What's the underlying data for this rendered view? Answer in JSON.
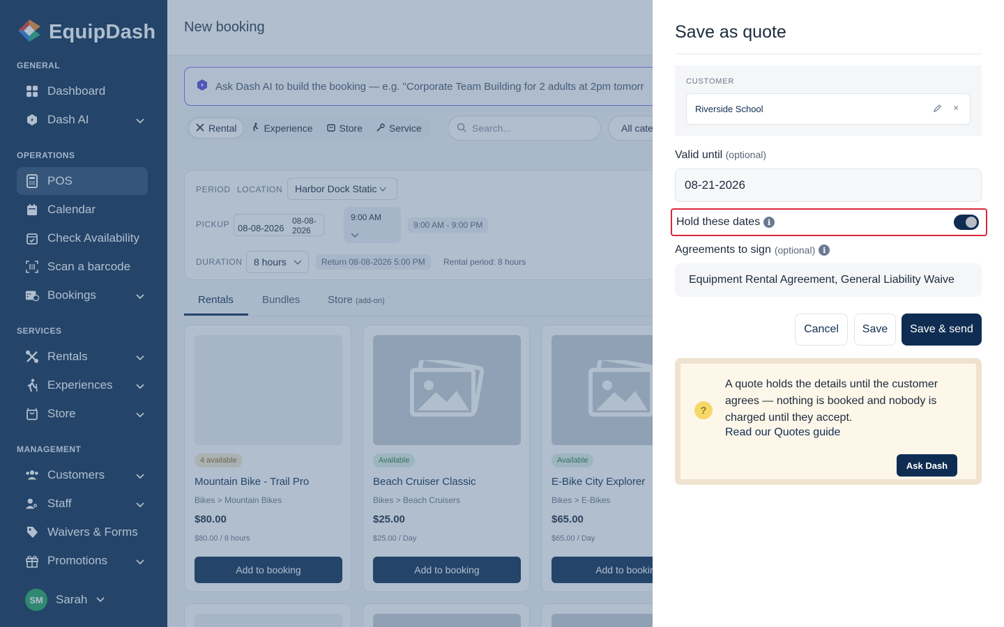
{
  "app": {
    "name": "EquipDash"
  },
  "sidebar": {
    "sections": {
      "general": "GENERAL",
      "operations": "OPERATIONS",
      "services": "SERVICES",
      "management": "MANAGEMENT"
    },
    "items": [
      {
        "label": "Dashboard"
      },
      {
        "label": "Dash AI"
      },
      {
        "label": "POS"
      },
      {
        "label": "Calendar"
      },
      {
        "label": "Check Availability"
      },
      {
        "label": "Scan a barcode"
      },
      {
        "label": "Bookings"
      },
      {
        "label": "Rentals"
      },
      {
        "label": "Experiences"
      },
      {
        "label": "Store"
      },
      {
        "label": "Customers"
      },
      {
        "label": "Staff"
      },
      {
        "label": "Waivers & Forms"
      },
      {
        "label": "Promotions"
      }
    ],
    "user": {
      "initials": "SM",
      "name": "Sarah"
    }
  },
  "main": {
    "title": "New booking",
    "ai_prompt": "Ask Dash AI to build the booking — e.g. \"Corporate Team Building for 2 adults at 2pm tomorr",
    "type_chips": [
      "Rental",
      "Experience",
      "Store",
      "Service"
    ],
    "search_placeholder": "Search...",
    "category_filter": "All cate",
    "period": {
      "period_label": "PERIOD",
      "location_label": "LOCATION",
      "location_value": "Harbor Dock Static",
      "pickup_label": "PICKUP",
      "pickup_date": "08-08-2026",
      "pickup_date2": "08-08-2026",
      "pickup_time": "9:00 AM",
      "hours": "9:00 AM - 9:00 PM",
      "duration_label": "DURATION",
      "duration_value": "8 hours",
      "return_text": "Return 08-08-2026 5:00 PM",
      "rental_period": "Rental period: 8 hours"
    },
    "tabs": [
      {
        "label": "Rentals"
      },
      {
        "label": "Bundles"
      },
      {
        "label": "Store",
        "suffix": "(add-on)"
      }
    ],
    "products": [
      {
        "badge": "4 available",
        "name": "Mountain Bike - Trail Pro",
        "category": "Bikes > Mountain Bikes",
        "price": "$80.00",
        "rate": "$80.00 / 8 hours",
        "button": "Add to booking"
      },
      {
        "badge": "Available",
        "name": "Beach Cruiser Classic",
        "category": "Bikes > Beach Cruisers",
        "price": "$25.00",
        "rate": "$25.00 / Day",
        "button": "Add to booking"
      },
      {
        "badge": "Available",
        "name": "E-Bike City Explorer",
        "category": "Bikes > E-Bikes",
        "price": "$65.00",
        "rate": "$65.00 / Day",
        "button": "Add to bookin"
      }
    ]
  },
  "quote": {
    "title": "Save as quote",
    "customer_label": "CUSTOMER",
    "customer_value": "Riverside School",
    "valid_until_label": "Valid until",
    "optional": "(optional)",
    "valid_until_value": "08-21-2026",
    "hold_label": "Hold these dates",
    "hold_enabled": true,
    "agreements_label": "Agreements to sign",
    "agreements_value": "Equipment Rental Agreement, General Liability Waive",
    "cancel": "Cancel",
    "save": "Save",
    "save_send": "Save & send",
    "help_text": "A quote holds the details until the customer agrees — nothing is booked and nobody is charged until they accept.",
    "help_link": "Read our Quotes guide",
    "help_button": "Ask Dash"
  },
  "colors": {
    "brand": "#0f2d52",
    "highlight": "#d8283a",
    "ai_border": "#7b6ee6"
  }
}
